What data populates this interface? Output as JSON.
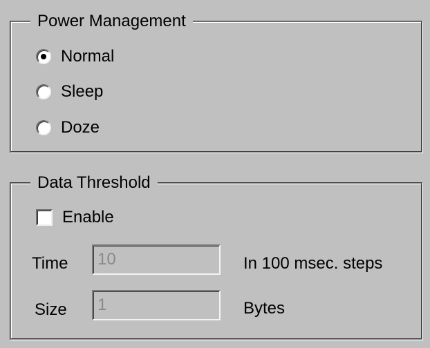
{
  "power_management": {
    "title": "Power Management",
    "options": [
      {
        "label": "Normal",
        "selected": true
      },
      {
        "label": "Sleep",
        "selected": false
      },
      {
        "label": "Doze",
        "selected": false
      }
    ]
  },
  "data_threshold": {
    "title": "Data Threshold",
    "enable": {
      "label": "Enable",
      "checked": false
    },
    "time": {
      "label": "Time",
      "value": "10",
      "unit": "In 100 msec. steps",
      "disabled": true
    },
    "size": {
      "label": "Size",
      "value": "1",
      "unit": "Bytes",
      "disabled": true
    }
  }
}
